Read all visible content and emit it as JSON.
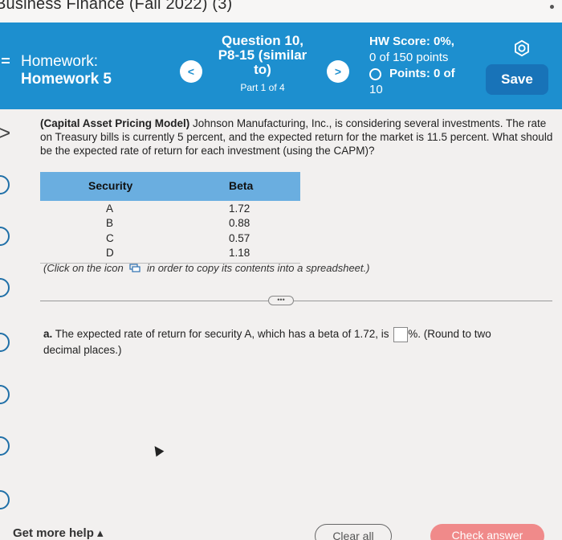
{
  "course": {
    "title": "Business Finance (Fall 2022) (3)"
  },
  "header": {
    "homework_label": "Homework:",
    "homework_name": "Homework 5",
    "prev_label": "<",
    "next_label": ">",
    "question_title": "Question 10, P8-15 (similar to)",
    "part": "Part 1 of 4",
    "hw_score": "HW Score: 0%,",
    "hw_points": "0 of 150 points",
    "points_label": "Points: 0 of",
    "points_total": "10",
    "save_label": "Save"
  },
  "problem": {
    "lead": "(Capital Asset Pricing Model)",
    "text": " Johnson Manufacturing, Inc., is considering several investments. The rate on Treasury bills is currently 5 percent, and the expected return for the market is 11.5 percent. What should be the expected rate of return for each investment (using the CAPM)?"
  },
  "table": {
    "headers": {
      "security": "Security",
      "beta": "Beta"
    },
    "rows": [
      {
        "security": "A",
        "beta": "1.72"
      },
      {
        "security": "B",
        "beta": "0.88"
      },
      {
        "security": "C",
        "beta": "0.57"
      },
      {
        "security": "D",
        "beta": "1.18"
      }
    ],
    "note_before": "(Click on the icon",
    "note_after": "in order to copy its contents into a spreadsheet.)"
  },
  "question_a": {
    "letter": "a.",
    "before": " The expected rate of return for security A, which has a beta of 1.72, is ",
    "after": "%. ",
    "hint": "(Round to two decimal places.)"
  },
  "footer": {
    "help_label": "Get more help ▴",
    "clear_label": "Clear all",
    "check_label": "Check answer"
  },
  "colors": {
    "header_blue": "#1d8fcf",
    "table_header": "#6aaee0",
    "check_button": "#f08a8a"
  }
}
